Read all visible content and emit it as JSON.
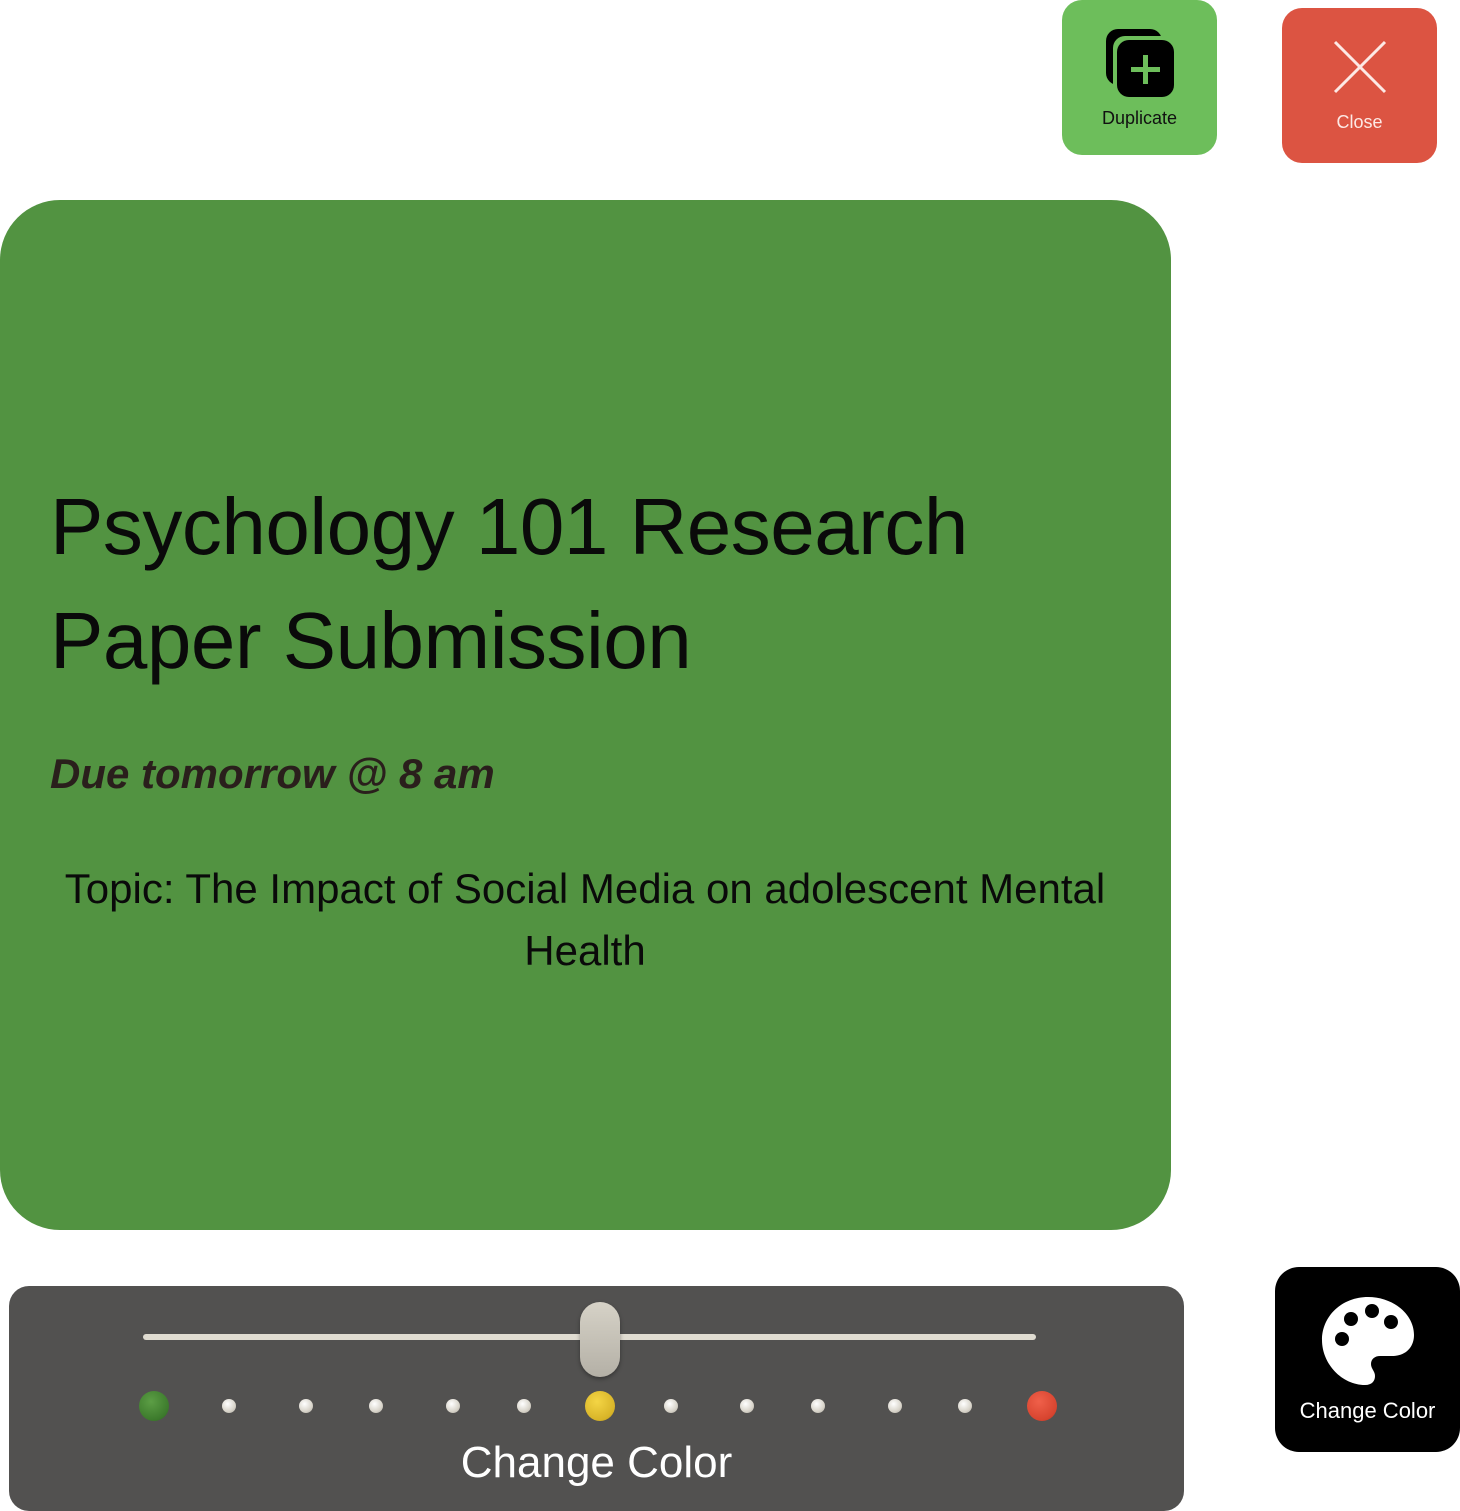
{
  "toolbar": {
    "duplicate_label": "Duplicate",
    "duplicate_icon": "duplicate-icon",
    "close_label": "Close",
    "close_icon": "close-icon"
  },
  "card": {
    "title": "Psychology 101 Research Paper Submission",
    "due": "Due tomorrow @ 8 am",
    "topic": "Topic: The Impact of Social Media on adolescent Mental Health",
    "background_color": "#529341"
  },
  "color_picker": {
    "label": "Change Color",
    "slider_value_fraction": 0.5,
    "swatches": [
      "green",
      "",
      "",
      "",
      "",
      "",
      "yellow",
      "",
      "",
      "",
      "",
      "",
      "red"
    ],
    "colors": {
      "green": "#3c7a2c",
      "yellow": "#d8b428",
      "red": "#d7442f"
    }
  },
  "palette_button": {
    "label": "Change Color",
    "icon": "palette-icon"
  },
  "colors": {
    "duplicate_bg": "#6dbe5b",
    "close_bg": "#dc5442",
    "panel_bg": "#525150"
  }
}
